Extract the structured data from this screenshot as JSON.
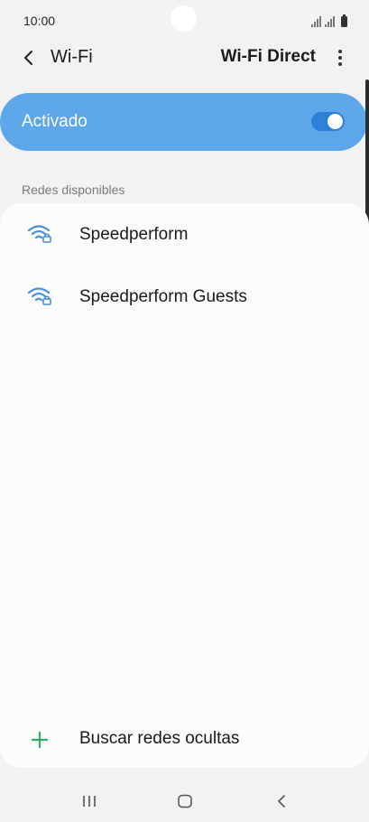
{
  "status_bar": {
    "time": "10:00"
  },
  "header": {
    "title": "Wi-Fi",
    "wifi_direct_label": "Wi-Fi Direct"
  },
  "master_toggle": {
    "label": "Activado",
    "on": true
  },
  "section": {
    "available_networks_label": "Redes disponibles"
  },
  "networks": [
    {
      "name": "Speedperform",
      "secured": true
    },
    {
      "name": "Speedperform Guests",
      "secured": true
    }
  ],
  "add_network": {
    "label": "Buscar redes ocultas"
  },
  "colors": {
    "accent": "#5ea6ea",
    "switch_track": "#2d7fd8",
    "wifi_icon": "#4a90d9",
    "add_icon": "#2fae6a"
  },
  "icons": {
    "back": "chevron-left-icon",
    "more": "more-vertical-icon",
    "wifi": "wifi-lock-icon",
    "add": "plus-icon",
    "nav_recents": "recents-icon",
    "nav_home": "home-icon",
    "nav_back": "back-icon"
  }
}
